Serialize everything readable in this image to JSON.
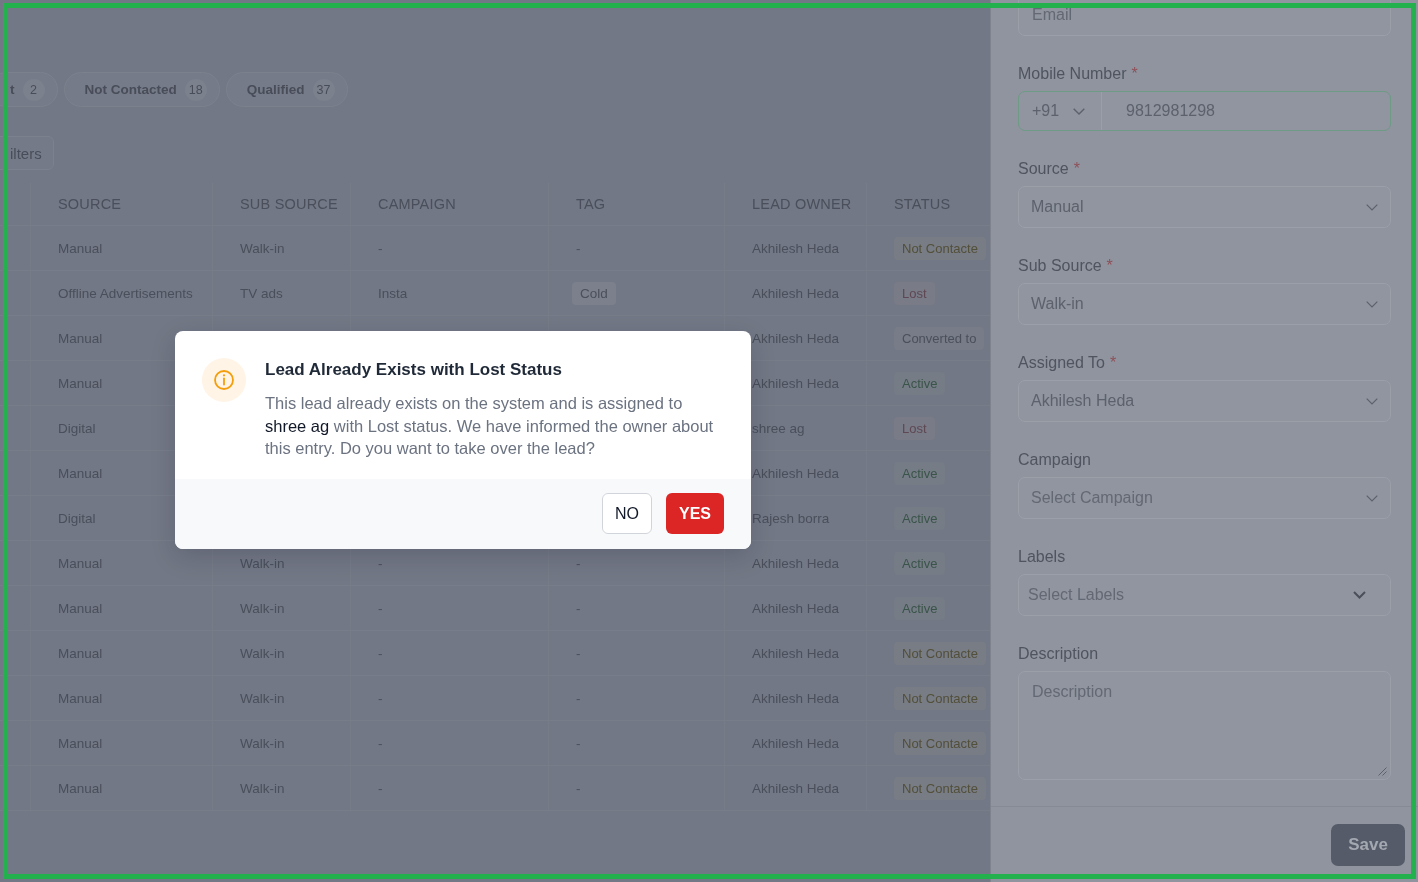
{
  "status_tabs": [
    {
      "label": "t",
      "count": "2",
      "selected": false
    },
    {
      "label": "Not Contacted",
      "count": "18",
      "selected": false
    },
    {
      "label": "Qualified",
      "count": "37",
      "selected": false
    }
  ],
  "filters_button": {
    "label": "ilters"
  },
  "table": {
    "columns": [
      "SOURCE",
      "SUB SOURCE",
      "CAMPAIGN",
      "TAG",
      "LEAD OWNER",
      "STATUS"
    ],
    "rows": [
      {
        "source": "Manual",
        "sub_source": "Walk-in",
        "campaign": "-",
        "tag": {
          "label": "-",
          "kind": "text"
        },
        "lead_owner": "Akhilesh Heda",
        "status": {
          "label": "Not Contacte",
          "color": "#524f3a"
        }
      },
      {
        "source": "Offline Advertisements",
        "sub_source": "TV ads",
        "campaign": "Insta",
        "tag": {
          "label": "Cold",
          "kind": "badge"
        },
        "lead_owner": "Akhilesh Heda",
        "status": {
          "label": "Lost",
          "color": "#5e4853"
        }
      },
      {
        "source": "Manual",
        "lead_owner": "Akhilesh Heda",
        "status": {
          "label": "Converted to",
          "color": "#4a4f5b"
        }
      },
      {
        "source": "Manual",
        "lead_owner": "Akhilesh Heda",
        "status": {
          "label": "Active",
          "color": "#3a5449"
        }
      },
      {
        "source": "Digital",
        "lead_owner": "shree ag",
        "status": {
          "label": "Lost",
          "color": "#5e4853"
        }
      },
      {
        "source": "Manual",
        "lead_owner": "Akhilesh Heda",
        "status": {
          "label": "Active",
          "color": "#3a5449"
        }
      },
      {
        "source": "Digital",
        "lead_owner": "Rajesh borra",
        "status": {
          "label": "Active",
          "color": "#3a5449"
        }
      },
      {
        "source": "Manual",
        "sub_source": "Walk-in",
        "campaign": "-",
        "tag": {
          "label": "-",
          "kind": "text"
        },
        "lead_owner": "Akhilesh Heda",
        "status": {
          "label": "Active",
          "color": "#3a5449"
        }
      },
      {
        "source": "Manual",
        "sub_source": "Walk-in",
        "campaign": "-",
        "tag": {
          "label": "-",
          "kind": "text"
        },
        "lead_owner": "Akhilesh Heda",
        "status": {
          "label": "Active",
          "color": "#3a5449"
        }
      },
      {
        "source": "Manual",
        "sub_source": "Walk-in",
        "campaign": "-",
        "tag": {
          "label": "-",
          "kind": "text"
        },
        "lead_owner": "Akhilesh Heda",
        "status": {
          "label": "Not Contacte",
          "color": "#524f3a"
        }
      },
      {
        "source": "Manual",
        "sub_source": "Walk-in",
        "campaign": "-",
        "tag": {
          "label": "-",
          "kind": "text"
        },
        "lead_owner": "Akhilesh Heda",
        "status": {
          "label": "Not Contacte",
          "color": "#524f3a"
        }
      },
      {
        "source": "Manual",
        "sub_source": "Walk-in",
        "campaign": "-",
        "tag": {
          "label": "-",
          "kind": "text"
        },
        "lead_owner": "Akhilesh Heda",
        "status": {
          "label": "Not Contacte",
          "color": "#524f3a"
        }
      },
      {
        "source": "Manual",
        "sub_source": "Walk-in",
        "campaign": "-",
        "tag": {
          "label": "-",
          "kind": "text"
        },
        "lead_owner": "Akhilesh Heda",
        "status": {
          "label": "Not Contacte",
          "color": "#524f3a"
        }
      }
    ]
  },
  "drawer": {
    "fields": [
      {
        "kind": "input",
        "placeholder": "Email",
        "focused": false
      },
      {
        "kind": "phone",
        "label": "Mobile Number",
        "required_mark": "*",
        "country_code": "+91",
        "value": "9812981298",
        "focused": true
      },
      {
        "kind": "select",
        "label": "Source",
        "required_mark": "*",
        "value": "Manual",
        "focused": false
      },
      {
        "kind": "select",
        "label": "Sub Source",
        "required_mark": "*",
        "value": "Walk-in",
        "focused": false
      },
      {
        "kind": "select",
        "label": "Assigned To",
        "required_mark": "*",
        "value": "Akhilesh Heda",
        "focused": false
      },
      {
        "kind": "select",
        "label": "Campaign",
        "placeholder": "Select Campaign",
        "focused": false
      },
      {
        "kind": "multiselect",
        "label": "Labels",
        "placeholder": "Select Labels",
        "focused": false
      },
      {
        "kind": "textarea",
        "label": "Description",
        "placeholder": "Description",
        "focused": false
      }
    ],
    "save_button": "Save"
  },
  "modal": {
    "title": "Lead Already Exists with Lost Status",
    "message": "This lead already exists on the system and is assigned to **shree ag** with Lost status. We have informed the owner about this entry. Do you want to take over the lead?",
    "buttons": [
      {
        "label": "NO",
        "kind": "secondary"
      },
      {
        "label": "YES",
        "kind": "primary"
      }
    ]
  }
}
